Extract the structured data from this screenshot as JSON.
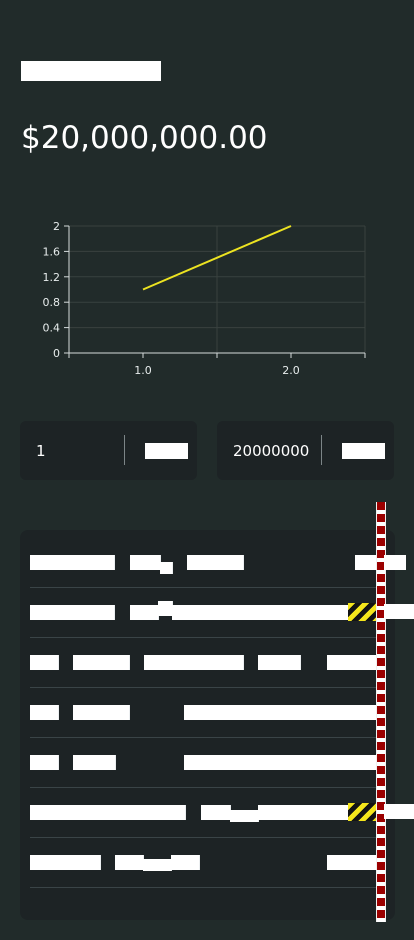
{
  "header": {
    "amount": "$20,000,000.00"
  },
  "chart_data": {
    "type": "line",
    "x": [
      1.0,
      2.0
    ],
    "series": [
      {
        "values": [
          1,
          2
        ],
        "color": "#ece321"
      }
    ],
    "xlabel": "",
    "ylabel": "",
    "xlim": [
      0.5,
      2.5
    ],
    "ylim": [
      0,
      2
    ],
    "x_ticks": [
      "1.0",
      "2.0"
    ],
    "y_ticks": [
      "0",
      "0.4",
      "0.8",
      "1.2",
      "1.6",
      "2"
    ],
    "grid": true
  },
  "inputs": {
    "left_value": "1",
    "right_value": "20000000"
  },
  "colors": {
    "background": "#212b2a",
    "panel": "#1d2325",
    "accent_line": "#ece321",
    "scroll_red": "#9b0000"
  }
}
